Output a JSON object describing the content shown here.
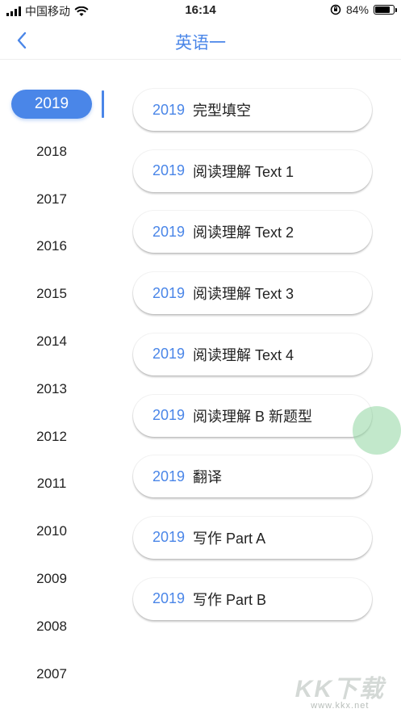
{
  "status": {
    "carrier": "中国移动",
    "time": "16:14",
    "battery": "84%",
    "battery_level": 0.84
  },
  "nav": {
    "title": "英语一"
  },
  "years": [
    "2019",
    "2018",
    "2017",
    "2016",
    "2015",
    "2014",
    "2013",
    "2012",
    "2011",
    "2010",
    "2009",
    "2008",
    "2007"
  ],
  "selected_year": "2019",
  "items": [
    {
      "year": "2019",
      "label": "完型填空"
    },
    {
      "year": "2019",
      "label": "阅读理解 Text 1"
    },
    {
      "year": "2019",
      "label": "阅读理解 Text 2"
    },
    {
      "year": "2019",
      "label": "阅读理解 Text 3"
    },
    {
      "year": "2019",
      "label": "阅读理解 Text 4"
    },
    {
      "year": "2019",
      "label": "阅读理解 B 新题型"
    },
    {
      "year": "2019",
      "label": "翻译"
    },
    {
      "year": "2019",
      "label": "写作 Part A"
    },
    {
      "year": "2019",
      "label": "写作 Part B"
    }
  ],
  "watermark": {
    "logo": "KK下载",
    "url": "www.kkx.net"
  },
  "colors": {
    "accent": "#4a86e8"
  }
}
